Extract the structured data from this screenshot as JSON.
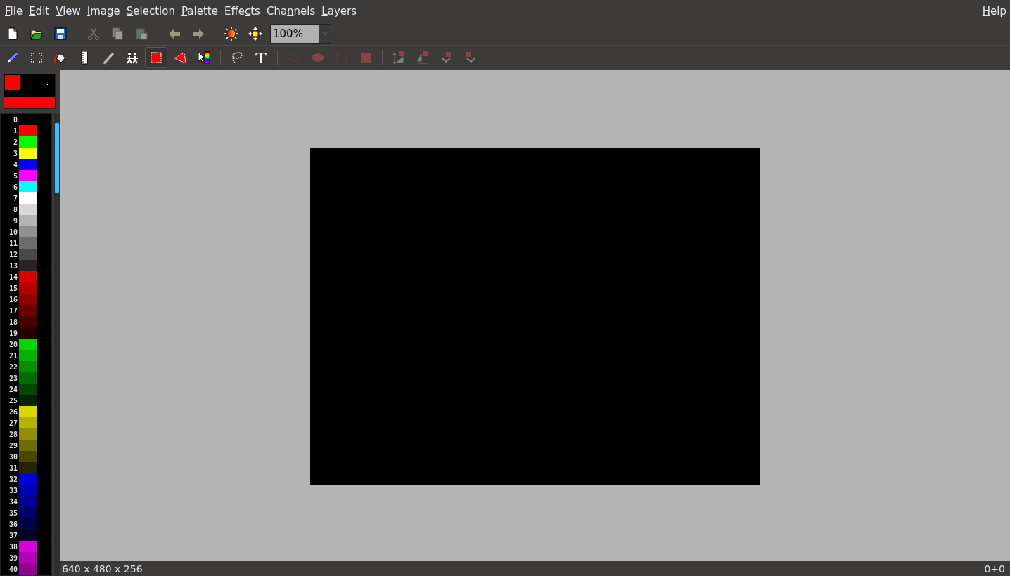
{
  "menu_bar": {
    "items": [
      {
        "key": "F",
        "post": "ile"
      },
      {
        "key": "E",
        "post": "dit"
      },
      {
        "key": "V",
        "post": "iew"
      },
      {
        "key": "I",
        "post": "mage"
      },
      {
        "key": "S",
        "post": "election"
      },
      {
        "key": "P",
        "post": "alette"
      },
      {
        "pre": "Effe",
        "key": "c",
        "post": "ts"
      },
      {
        "pre": "Cha",
        "key": "n",
        "post": "nels"
      },
      {
        "key": "L",
        "post": "ayers"
      }
    ],
    "right_items": [
      {
        "key": "H",
        "post": "elp"
      }
    ]
  },
  "main_toolbar": {
    "groups": [
      [
        {
          "kind": "new",
          "disabled": false
        },
        {
          "kind": "open",
          "disabled": false
        },
        {
          "kind": "save",
          "disabled": false
        }
      ],
      [
        {
          "kind": "cut",
          "disabled": true
        },
        {
          "kind": "copy",
          "disabled": true
        },
        {
          "kind": "paste",
          "disabled": true
        }
      ],
      [
        {
          "kind": "undo",
          "disabled": true
        },
        {
          "kind": "redo",
          "disabled": true
        }
      ],
      [
        {
          "kind": "sun",
          "disabled": false
        },
        {
          "kind": "move",
          "disabled": false
        }
      ]
    ],
    "zoom": {
      "value": "100%"
    }
  },
  "tools_toolbar": {
    "groups": [
      [
        {
          "kind": "pencil",
          "selected": false,
          "disabled": false
        },
        {
          "kind": "line",
          "selected": false,
          "disabled": false
        },
        {
          "kind": "fill",
          "selected": false,
          "disabled": false
        },
        {
          "kind": "ruler",
          "selected": false,
          "disabled": false
        },
        {
          "kind": "smudge",
          "selected": false,
          "disabled": false
        },
        {
          "kind": "people",
          "selected": false,
          "disabled": false
        },
        {
          "kind": "rect_select",
          "selected": true,
          "disabled": false
        },
        {
          "kind": "polygon",
          "selected": false,
          "disabled": false
        },
        {
          "kind": "picker",
          "selected": false,
          "disabled": false
        }
      ],
      [
        {
          "kind": "lasso",
          "selected": false,
          "disabled": false
        },
        {
          "kind": "text",
          "label": "T",
          "selected": false,
          "disabled": false
        }
      ],
      [
        {
          "kind": "ellipse_outline",
          "selected": false,
          "disabled": true
        },
        {
          "kind": "ellipse_fill",
          "selected": false,
          "disabled": true
        },
        {
          "kind": "rect_outline",
          "selected": false,
          "disabled": true
        },
        {
          "kind": "rect_fill",
          "selected": false,
          "disabled": true
        }
      ],
      [
        {
          "kind": "flip_v",
          "selected": false,
          "disabled": true
        },
        {
          "kind": "flip_h",
          "selected": false,
          "disabled": true
        },
        {
          "kind": "rotate_left",
          "selected": false,
          "disabled": true
        },
        {
          "kind": "rotate_right",
          "selected": false,
          "disabled": true
        }
      ]
    ]
  },
  "color_preview": [
    {
      "kind": "background",
      "color": "#000000"
    },
    {
      "kind": "foreground",
      "color": "#ff0000"
    },
    {
      "kind": "pattern",
      "color": "#ff0000"
    }
  ],
  "palette": [
    {
      "index": "0",
      "color": "#000000"
    },
    {
      "index": "1",
      "color": "#ff0000"
    },
    {
      "index": "2",
      "color": "#00ff00"
    },
    {
      "index": "3",
      "color": "#ffff00"
    },
    {
      "index": "4",
      "color": "#0000ff"
    },
    {
      "index": "5",
      "color": "#ff00ff"
    },
    {
      "index": "6",
      "color": "#00ffff"
    },
    {
      "index": "7",
      "color": "#ffffff"
    },
    {
      "index": "8",
      "color": "#d8d8d8"
    },
    {
      "index": "9",
      "color": "#b4b4b4"
    },
    {
      "index": "10",
      "color": "#909090"
    },
    {
      "index": "11",
      "color": "#6c6c6c"
    },
    {
      "index": "12",
      "color": "#484848"
    },
    {
      "index": "13",
      "color": "#242424"
    },
    {
      "index": "14",
      "color": "#d80000"
    },
    {
      "index": "15",
      "color": "#b40000"
    },
    {
      "index": "16",
      "color": "#900000"
    },
    {
      "index": "17",
      "color": "#6c0000"
    },
    {
      "index": "18",
      "color": "#480000"
    },
    {
      "index": "19",
      "color": "#240000"
    },
    {
      "index": "20",
      "color": "#00d800"
    },
    {
      "index": "21",
      "color": "#00b400"
    },
    {
      "index": "22",
      "color": "#009000"
    },
    {
      "index": "23",
      "color": "#006c00"
    },
    {
      "index": "24",
      "color": "#004800"
    },
    {
      "index": "25",
      "color": "#002400"
    },
    {
      "index": "26",
      "color": "#d8d800"
    },
    {
      "index": "27",
      "color": "#b4b400"
    },
    {
      "index": "28",
      "color": "#909000"
    },
    {
      "index": "29",
      "color": "#6c6c00"
    },
    {
      "index": "30",
      "color": "#484800"
    },
    {
      "index": "31",
      "color": "#242400"
    },
    {
      "index": "32",
      "color": "#0000d8"
    },
    {
      "index": "33",
      "color": "#0000b4"
    },
    {
      "index": "34",
      "color": "#000090"
    },
    {
      "index": "35",
      "color": "#00006c"
    },
    {
      "index": "36",
      "color": "#000048"
    },
    {
      "index": "37",
      "color": "#000024"
    },
    {
      "index": "38",
      "color": "#d800d8"
    },
    {
      "index": "39",
      "color": "#b400b4"
    },
    {
      "index": "40",
      "color": "#900090"
    }
  ],
  "status_bar": {
    "image_info": "640 x 480 x 256",
    "position": "0+0"
  }
}
